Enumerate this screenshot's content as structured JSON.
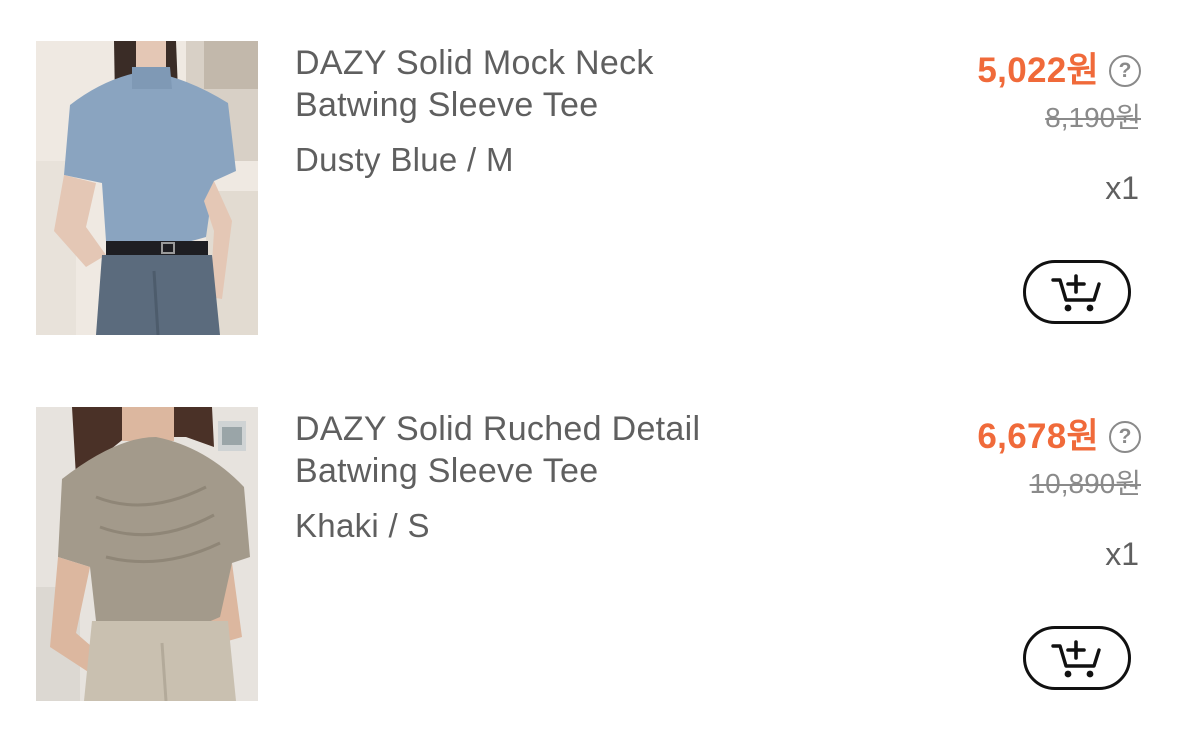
{
  "items": [
    {
      "title": "DAZY Solid Mock Neck\nBatwing Sleeve Tee",
      "variant": "Dusty Blue / M",
      "price": "5,022원",
      "original_price": "8,190원",
      "quantity": "x1",
      "help_icon": "question-circle-icon",
      "cart_icon": "add-to-cart-icon",
      "image_palette": {
        "top": "#8aa4c0",
        "bottom": "#5b6b7d",
        "background": "#efe9e2"
      }
    },
    {
      "title": "DAZY Solid Ruched Detail\nBatwing Sleeve Tee",
      "variant": "Khaki / S",
      "price": "6,678원",
      "original_price": "10,890원",
      "quantity": "x1",
      "help_icon": "question-circle-icon",
      "cart_icon": "add-to-cart-icon",
      "image_palette": {
        "top": "#a39a8b",
        "bottom": "#c9c0b0",
        "background": "#e7e3de"
      }
    }
  ],
  "colors": {
    "price_accent": "#f06a3a",
    "text_primary": "#5f5f5f",
    "text_muted": "#8a8a8a"
  }
}
